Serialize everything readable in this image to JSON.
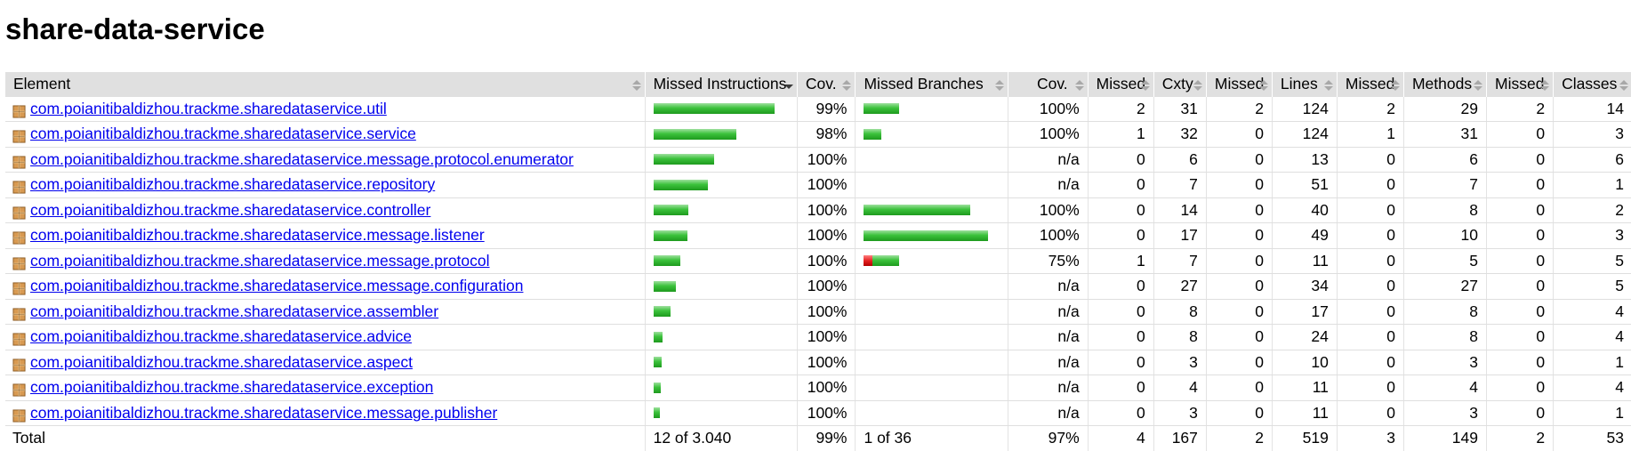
{
  "title": "share-data-service",
  "colors": {
    "header_bg": "#e0e0e0",
    "link": "#0000ee",
    "bar_green": "#3cc23c",
    "bar_red": "#e62222"
  },
  "headers": {
    "element": "Element",
    "missed_instructions": "Missed Instructions",
    "cov": "Cov.",
    "missed_branches": "Missed Branches",
    "cov2": "Cov.",
    "missed_cxty": "Missed",
    "cxty": "Cxty",
    "missed_lines": "Missed",
    "lines": "Lines",
    "missed_methods": "Missed",
    "methods": "Methods",
    "missed_classes": "Missed",
    "classes": "Classes"
  },
  "rows": [
    {
      "name": "com.poianitibaldizhou.trackme.sharedataservice.util",
      "instr_cov": "99%",
      "instr_bar": 0.985,
      "instr_missed_frac": 0.0,
      "branch_cov": "100%",
      "branch_bar": 0.285,
      "branch_missed_frac": 0.0,
      "missed_cxty": "2",
      "cxty": "31",
      "missed_lines": "2",
      "lines": "124",
      "missed_methods": "2",
      "methods": "29",
      "missed_classes": "2",
      "classes": "14"
    },
    {
      "name": "com.poianitibaldizhou.trackme.sharedataservice.service",
      "instr_cov": "98%",
      "instr_bar": 0.675,
      "instr_missed_frac": 0.0,
      "branch_cov": "100%",
      "branch_bar": 0.14,
      "branch_missed_frac": 0.0,
      "missed_cxty": "1",
      "cxty": "32",
      "missed_lines": "0",
      "lines": "124",
      "missed_methods": "1",
      "methods": "31",
      "missed_classes": "0",
      "classes": "3"
    },
    {
      "name": "com.poianitibaldizhou.trackme.sharedataservice.message.protocol.enumerator",
      "instr_cov": "100%",
      "instr_bar": 0.49,
      "instr_missed_frac": 0.0,
      "branch_cov": "n/a",
      "branch_bar": 0,
      "branch_missed_frac": 0,
      "missed_cxty": "0",
      "cxty": "6",
      "missed_lines": "0",
      "lines": "13",
      "missed_methods": "0",
      "methods": "6",
      "missed_classes": "0",
      "classes": "6"
    },
    {
      "name": "com.poianitibaldizhou.trackme.sharedataservice.repository",
      "instr_cov": "100%",
      "instr_bar": 0.44,
      "instr_missed_frac": 0.0,
      "branch_cov": "n/a",
      "branch_bar": 0,
      "branch_missed_frac": 0,
      "missed_cxty": "0",
      "cxty": "7",
      "missed_lines": "0",
      "lines": "51",
      "missed_methods": "0",
      "methods": "7",
      "missed_classes": "0",
      "classes": "1"
    },
    {
      "name": "com.poianitibaldizhou.trackme.sharedataservice.controller",
      "instr_cov": "100%",
      "instr_bar": 0.28,
      "instr_missed_frac": 0.0,
      "branch_cov": "100%",
      "branch_bar": 0.855,
      "branch_missed_frac": 0.0,
      "missed_cxty": "0",
      "cxty": "14",
      "missed_lines": "0",
      "lines": "40",
      "missed_methods": "0",
      "methods": "8",
      "missed_classes": "0",
      "classes": "2"
    },
    {
      "name": "com.poianitibaldizhou.trackme.sharedataservice.message.listener",
      "instr_cov": "100%",
      "instr_bar": 0.275,
      "instr_missed_frac": 0.0,
      "branch_cov": "100%",
      "branch_bar": 1.0,
      "branch_missed_frac": 0.0,
      "missed_cxty": "0",
      "cxty": "17",
      "missed_lines": "0",
      "lines": "49",
      "missed_methods": "0",
      "methods": "10",
      "missed_classes": "0",
      "classes": "3"
    },
    {
      "name": "com.poianitibaldizhou.trackme.sharedataservice.message.protocol",
      "instr_cov": "100%",
      "instr_bar": 0.22,
      "instr_missed_frac": 0.0,
      "branch_cov": "75%",
      "branch_bar": 0.285,
      "branch_missed_frac": 0.25,
      "missed_cxty": "1",
      "cxty": "7",
      "missed_lines": "0",
      "lines": "11",
      "missed_methods": "0",
      "methods": "5",
      "missed_classes": "0",
      "classes": "5"
    },
    {
      "name": "com.poianitibaldizhou.trackme.sharedataservice.message.configuration",
      "instr_cov": "100%",
      "instr_bar": 0.18,
      "instr_missed_frac": 0.0,
      "branch_cov": "n/a",
      "branch_bar": 0,
      "branch_missed_frac": 0,
      "missed_cxty": "0",
      "cxty": "27",
      "missed_lines": "0",
      "lines": "34",
      "missed_methods": "0",
      "methods": "27",
      "missed_classes": "0",
      "classes": "5"
    },
    {
      "name": "com.poianitibaldizhou.trackme.sharedataservice.assembler",
      "instr_cov": "100%",
      "instr_bar": 0.14,
      "instr_missed_frac": 0.0,
      "branch_cov": "n/a",
      "branch_bar": 0,
      "branch_missed_frac": 0,
      "missed_cxty": "0",
      "cxty": "8",
      "missed_lines": "0",
      "lines": "17",
      "missed_methods": "0",
      "methods": "8",
      "missed_classes": "0",
      "classes": "4"
    },
    {
      "name": "com.poianitibaldizhou.trackme.sharedataservice.advice",
      "instr_cov": "100%",
      "instr_bar": 0.07,
      "instr_missed_frac": 0.0,
      "branch_cov": "n/a",
      "branch_bar": 0,
      "branch_missed_frac": 0,
      "missed_cxty": "0",
      "cxty": "8",
      "missed_lines": "0",
      "lines": "24",
      "missed_methods": "0",
      "methods": "8",
      "missed_classes": "0",
      "classes": "4"
    },
    {
      "name": "com.poianitibaldizhou.trackme.sharedataservice.aspect",
      "instr_cov": "100%",
      "instr_bar": 0.065,
      "instr_missed_frac": 0.0,
      "branch_cov": "n/a",
      "branch_bar": 0,
      "branch_missed_frac": 0,
      "missed_cxty": "0",
      "cxty": "3",
      "missed_lines": "0",
      "lines": "10",
      "missed_methods": "0",
      "methods": "3",
      "missed_classes": "0",
      "classes": "1"
    },
    {
      "name": "com.poianitibaldizhou.trackme.sharedataservice.exception",
      "instr_cov": "100%",
      "instr_bar": 0.055,
      "instr_missed_frac": 0.0,
      "branch_cov": "n/a",
      "branch_bar": 0,
      "branch_missed_frac": 0,
      "missed_cxty": "0",
      "cxty": "4",
      "missed_lines": "0",
      "lines": "11",
      "missed_methods": "0",
      "methods": "4",
      "missed_classes": "0",
      "classes": "4"
    },
    {
      "name": "com.poianitibaldizhou.trackme.sharedataservice.message.publisher",
      "instr_cov": "100%",
      "instr_bar": 0.05,
      "instr_missed_frac": 0.0,
      "branch_cov": "n/a",
      "branch_bar": 0,
      "branch_missed_frac": 0,
      "missed_cxty": "0",
      "cxty": "3",
      "missed_lines": "0",
      "lines": "11",
      "missed_methods": "0",
      "methods": "3",
      "missed_classes": "0",
      "classes": "1"
    }
  ],
  "total": {
    "label": "Total",
    "missed_instructions": "12 of 3.040",
    "instr_cov": "99%",
    "missed_branches": "1 of 36",
    "branch_cov": "97%",
    "missed_cxty": "4",
    "cxty": "167",
    "missed_lines": "2",
    "lines": "519",
    "missed_methods": "3",
    "methods": "149",
    "missed_classes": "2",
    "classes": "53"
  }
}
